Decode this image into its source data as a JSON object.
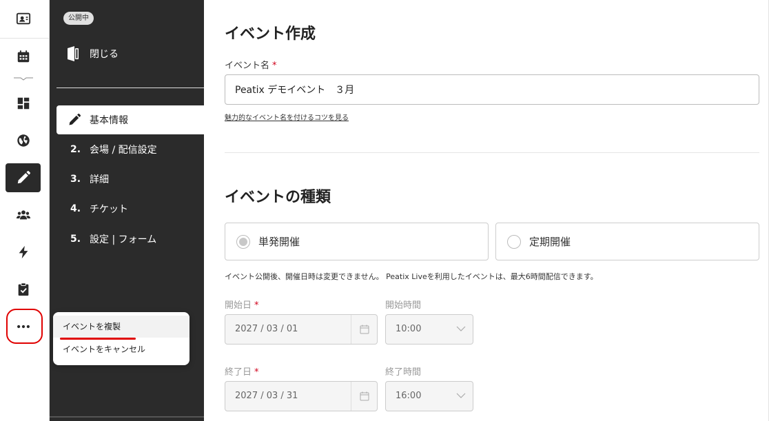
{
  "rail": {
    "icons": [
      "id-card-icon",
      "calendar-icon",
      "chevron-expand-icon",
      "dashboard-icon",
      "globe-icon",
      "pencil-icon",
      "users-icon",
      "lightning-icon",
      "clipboard-check-icon",
      "more-icon"
    ]
  },
  "sidebar": {
    "status_badge": "公開中",
    "close_label": "閉じる",
    "steps": [
      {
        "num": "",
        "label": "基本情報"
      },
      {
        "num": "2.",
        "label": "会場 / 配信設定"
      },
      {
        "num": "3.",
        "label": "詳細"
      },
      {
        "num": "4.",
        "label": "チケット"
      },
      {
        "num": "5.",
        "label": "設定 | フォーム"
      }
    ]
  },
  "popup": {
    "duplicate_label": "イベントを複製",
    "cancel_label": "イベントをキャンセル"
  },
  "main": {
    "create_title": "イベント作成",
    "event_name_label": "イベント名",
    "required_mark": "*",
    "event_name_value": "Peatix デモイベント　３月",
    "tips_link": "魅力的なイベント名を付けるコツを見る",
    "type_title": "イベントの種類",
    "type_options": [
      {
        "label": "単発開催",
        "selected": true
      },
      {
        "label": "定期開催",
        "selected": false
      }
    ],
    "type_note": "イベント公開後、開催日時は変更できません。 Peatix Liveを利用したイベントは、最大6時間配信できます。",
    "start_date_label": "開始日",
    "start_date_value": "2027 / 03 / 01",
    "start_time_label": "開始時間",
    "start_time_value": "10:00",
    "end_date_label": "終了日",
    "end_date_value": "2027 / 03 / 31",
    "end_time_label": "終了時間",
    "end_time_value": "16:00"
  },
  "colors": {
    "sidebar_bg": "#2b2b2b",
    "highlight_red": "#e00000",
    "required_red": "#d0021b"
  }
}
